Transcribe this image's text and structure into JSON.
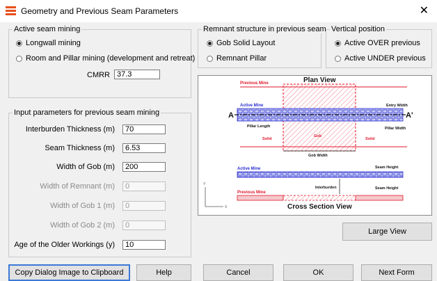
{
  "window": {
    "title": "Geometry and Previous Seam Parameters",
    "close_symbol": "✕"
  },
  "active_mining": {
    "legend": "Active seam mining",
    "options": [
      "Longwall mining",
      "Room and Pillar mining (development and retreat)"
    ],
    "selected": "Longwall mining",
    "cmrr_label": "CMRR",
    "cmrr_value": "37.3"
  },
  "remnant": {
    "legend": "Remnant structure in previous seam",
    "options": [
      "Gob Solid Layout",
      "Remnant Pillar"
    ],
    "selected": "Gob Solid Layout"
  },
  "vertical": {
    "legend": "Vertical position",
    "options": [
      "Active OVER previous",
      "Active UNDER previous"
    ],
    "selected": "Active OVER previous"
  },
  "params": {
    "legend": "Input parameters for previous seam mining",
    "rows": [
      {
        "label": "Interburden Thickness (m)",
        "value": "70",
        "enabled": true
      },
      {
        "label": "Seam Thickness (m)",
        "value": "6.53",
        "enabled": true
      },
      {
        "label": "Width of Gob (m)",
        "value": "200",
        "enabled": true
      },
      {
        "label": "Width of Remnant (m)",
        "value": "0",
        "enabled": false
      },
      {
        "label": "Width of Gob 1 (m)",
        "value": "0",
        "enabled": false
      },
      {
        "label": "Width of Gob 2 (m)",
        "value": "0",
        "enabled": false
      },
      {
        "label": "Age of the Older Workings (y)",
        "value": "10",
        "enabled": true
      }
    ]
  },
  "diagram": {
    "plan_title": "Plan View",
    "cross_title": "Cross Section View",
    "previous_mine": "Previous Mine",
    "active_mine": "Active Mine",
    "a_left": "A",
    "a_right": "A'",
    "entry_width": "Entry Width",
    "pillar_length": "Pillar Length",
    "pillar_width": "Pillar Width",
    "solid_label": "Solid",
    "gob_label": "Gob",
    "gob_width": "Gob Width",
    "seam_height": "Seam Height",
    "interburden": "Interburden",
    "axis_y": "Y",
    "axis_x": "X",
    "colors": {
      "red": "#e0162a",
      "blue": "#2b2fd0",
      "hatch": "#f07a84",
      "black": "#111111"
    }
  },
  "buttons": {
    "large_view": "Large View",
    "copy": "Copy Dialog Image to Clipboard",
    "help": "Help",
    "cancel": "Cancel",
    "ok": "OK",
    "next": "Next Form"
  }
}
